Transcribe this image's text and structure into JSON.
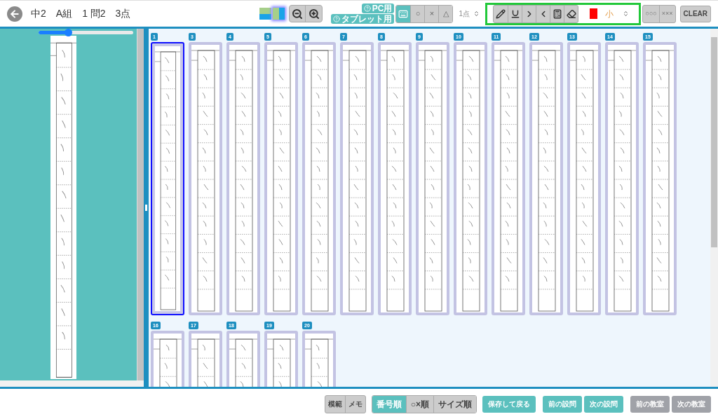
{
  "header": {
    "title_parts": [
      "中2",
      "A組",
      "1 問2",
      "3点"
    ]
  },
  "layout_buttons": [
    {
      "kind": "stacked",
      "selected": false
    },
    {
      "kind": "side",
      "selected": true
    }
  ],
  "help_links": [
    "PC用",
    "タブレット用"
  ],
  "mark_buttons": [
    {
      "kind": "keyboard",
      "selected": true
    },
    {
      "kind": "text",
      "label": "○",
      "selected": false
    },
    {
      "kind": "text",
      "label": "×",
      "selected": false
    },
    {
      "kind": "text",
      "label": "△",
      "selected": false
    }
  ],
  "points_select": {
    "value": "1点"
  },
  "tools": [
    {
      "kind": "pencil"
    },
    {
      "kind": "underline"
    },
    {
      "kind": "greater"
    },
    {
      "kind": "less"
    },
    {
      "kind": "calculator"
    },
    {
      "kind": "eraser"
    }
  ],
  "pen": {
    "color": "#ff0000",
    "size": "小"
  },
  "bulk_buttons": [
    "○○○",
    "×××"
  ],
  "clear_button": "CLEAR",
  "preview": {
    "zoom": {
      "level": 0.31
    }
  },
  "cards": [
    {
      "number": "1",
      "selected": true
    },
    {
      "number": "3",
      "selected": false
    },
    {
      "number": "4",
      "selected": false
    },
    {
      "number": "5",
      "selected": false
    },
    {
      "number": "6",
      "selected": false
    },
    {
      "number": "7",
      "selected": false
    },
    {
      "number": "8",
      "selected": false
    },
    {
      "number": "9",
      "selected": false
    },
    {
      "number": "10",
      "selected": false
    },
    {
      "number": "11",
      "selected": false
    },
    {
      "number": "12",
      "selected": false
    },
    {
      "number": "13",
      "selected": false
    },
    {
      "number": "14",
      "selected": false
    },
    {
      "number": "15",
      "selected": false
    },
    {
      "number": "16",
      "selected": false
    },
    {
      "number": "17",
      "selected": false
    },
    {
      "number": "18",
      "selected": false
    },
    {
      "number": "19",
      "selected": false
    },
    {
      "number": "20",
      "selected": false
    }
  ],
  "view_buttons": [
    "模範",
    "メモ"
  ],
  "sort_buttons": [
    {
      "label": "番号順",
      "selected": true
    },
    {
      "label": "○×順",
      "selected": false
    },
    {
      "label": "サイズ順",
      "selected": false
    }
  ],
  "nav_buttons": [
    {
      "label": "保存して戻る",
      "kind": "primary"
    },
    {
      "label": "前の設問",
      "kind": "primary"
    },
    {
      "label": "次の設問",
      "kind": "primary"
    },
    {
      "label": "前の教室",
      "kind": "secondary"
    },
    {
      "label": "次の教室",
      "kind": "secondary"
    }
  ]
}
